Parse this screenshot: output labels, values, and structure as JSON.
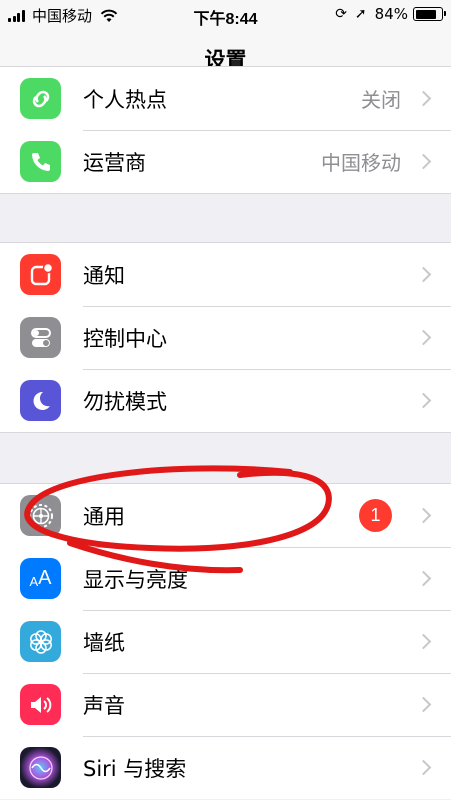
{
  "status_bar": {
    "carrier": "中国移动",
    "time": "下午8:44",
    "battery_percent": "84%",
    "battery_level": 0.84
  },
  "nav": {
    "title": "设置"
  },
  "groups": [
    {
      "rows": [
        {
          "label": "个人热点",
          "value": "关闭",
          "icon": "hotspot-icon",
          "color": "#4cd964"
        },
        {
          "label": "运营商",
          "value": "中国移动",
          "icon": "phone-icon",
          "color": "#4cd964"
        }
      ]
    },
    {
      "rows": [
        {
          "label": "通知",
          "icon": "notifications-icon",
          "color": "#ff3b30"
        },
        {
          "label": "控制中心",
          "icon": "control-center-icon",
          "color": "#8e8e93"
        },
        {
          "label": "勿扰模式",
          "icon": "moon-icon",
          "color": "#5856d6"
        }
      ]
    },
    {
      "rows": [
        {
          "label": "通用",
          "badge": "1",
          "icon": "gear-icon",
          "color": "#8e8e93"
        },
        {
          "label": "显示与亮度",
          "icon": "display-brightness-icon",
          "color": "#007aff"
        },
        {
          "label": "墙纸",
          "icon": "wallpaper-icon",
          "color": "#34aadc"
        },
        {
          "label": "声音",
          "icon": "speaker-icon",
          "color": "#ff2d55"
        },
        {
          "label": "Siri 与搜索",
          "icon": "siri-icon",
          "color": "#1a1a2e"
        }
      ]
    }
  ],
  "annotation": {
    "color": "#e01818"
  }
}
